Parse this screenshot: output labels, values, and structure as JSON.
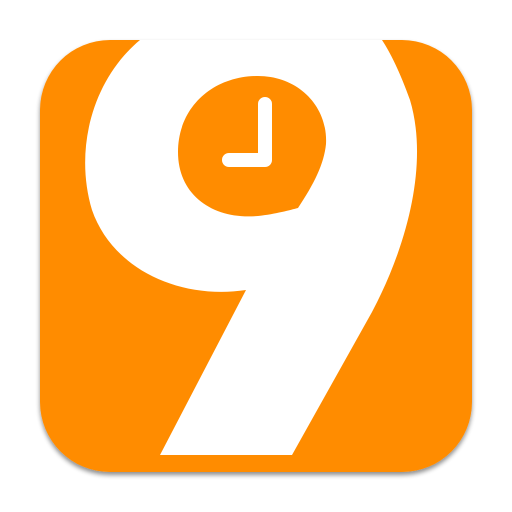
{
  "app_icon": {
    "icon": "nine-clock-logo-icon",
    "background_color": "#FF8C00",
    "glyph_color": "#FFFFFF",
    "shadow_color": "#9a9a9a"
  }
}
